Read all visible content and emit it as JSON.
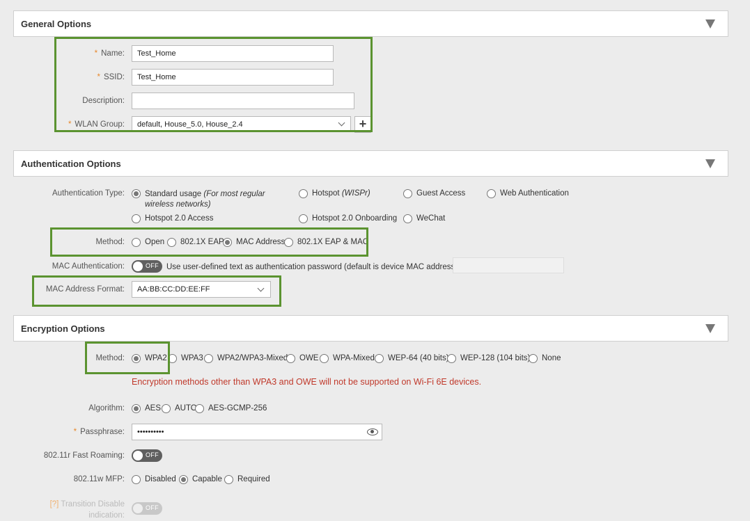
{
  "general": {
    "title": "General Options",
    "name_label": "Name:",
    "name_value": "Test_Home",
    "ssid_label": "SSID:",
    "ssid_value": "Test_Home",
    "description_label": "Description:",
    "description_value": "",
    "wlan_group_label": "WLAN Group:",
    "wlan_group_value": "default, House_5.0, House_2.4",
    "add_symbol": "+",
    "required_mark": "*"
  },
  "auth": {
    "title": "Authentication Options",
    "type_label": "Authentication Type:",
    "types": {
      "standard_main": "Standard usage ",
      "standard_note": "(For most regular wireless networks)",
      "hotspot_wispr": "Hotspot (WISPr)",
      "guest_access": "Guest Access",
      "web_auth": "Web Authentication",
      "hotspot20_access": "Hotspot 2.0 Access",
      "hotspot20_onboarding": "Hotspot 2.0 Onboarding",
      "wechat": "WeChat"
    },
    "method_label": "Method:",
    "methods": [
      "Open",
      "802.1X EAP",
      "MAC Address",
      "802.1X EAP & MAC"
    ],
    "method_selected": "MAC Address",
    "mac_auth_label": "MAC Authentication:",
    "mac_auth_toggle": "OFF",
    "mac_auth_text": "Use user-defined text as authentication password (default is device MAC address):",
    "mac_format_label": "MAC Address Format:",
    "mac_format_value": "AA:BB:CC:DD:EE:FF"
  },
  "encryption": {
    "title": "Encryption Options",
    "method_label": "Method:",
    "methods": [
      "WPA2",
      "WPA3",
      "WPA2/WPA3-Mixed",
      "OWE",
      "WPA-Mixed",
      "WEP-64 (40 bits)",
      "WEP-128 (104 bits)",
      "None"
    ],
    "method_selected": "WPA2",
    "warning": "Encryption methods other than WPA3 and OWE will not be supported on Wi-Fi 6E devices.",
    "algorithm_label": "Algorithm:",
    "algorithms": [
      "AES",
      "AUTO",
      "AES-GCMP-256"
    ],
    "algorithm_selected": "AES",
    "passphrase_label": "Passphrase:",
    "passphrase_value": "••••••••••",
    "fast_roaming_label": "802.11r Fast Roaming:",
    "fast_roaming_toggle": "OFF",
    "mfp_label": "802.11w MFP:",
    "mfp_options": [
      "Disabled",
      "Capable",
      "Required"
    ],
    "mfp_selected": "Capable",
    "transition_help": "[?]",
    "transition_label": "Transition Disable indication:",
    "transition_toggle": "OFF"
  },
  "colors": {
    "highlight": "#5b9330",
    "required": "#e8882b",
    "warning": "#c0392b"
  }
}
